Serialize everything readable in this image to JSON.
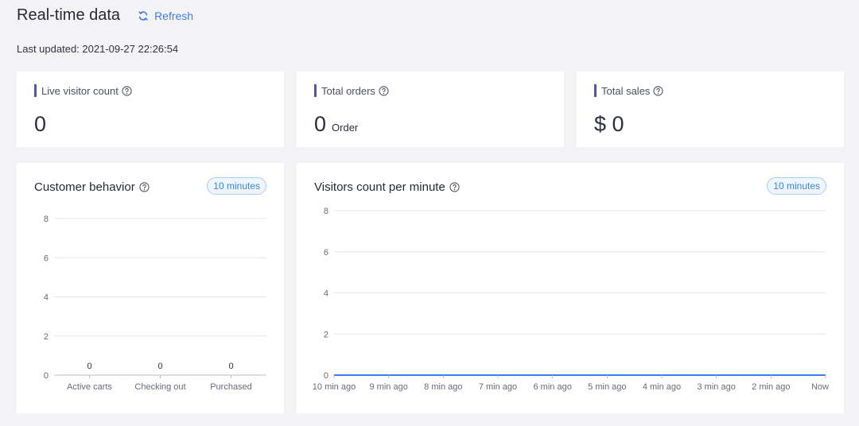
{
  "header": {
    "title": "Real-time data",
    "refresh_label": "Refresh",
    "last_updated": "Last updated: 2021-09-27 22:26:54"
  },
  "stats": [
    {
      "label": "Live visitor count",
      "value": "0",
      "unit": ""
    },
    {
      "label": "Total orders",
      "value": "0",
      "unit": "Order"
    },
    {
      "label": "Total sales",
      "value": "$ 0",
      "unit": ""
    }
  ],
  "charts": {
    "behavior": {
      "title": "Customer behavior",
      "range": "10 minutes"
    },
    "visitors": {
      "title": "Visitors count per minute",
      "range": "10 minutes"
    }
  },
  "colors": {
    "accent": "#3b7cf0",
    "stat_bar": "#4857b8",
    "line": "#3b7cf0"
  },
  "chart_data": [
    {
      "type": "bar",
      "title": "Customer behavior",
      "categories": [
        "Active carts",
        "Checking out",
        "Purchased"
      ],
      "values": [
        0,
        0,
        0
      ],
      "data_labels": [
        "0",
        "0",
        "0"
      ],
      "yticks": [
        "0",
        "2",
        "4",
        "6",
        "8"
      ],
      "ylim": [
        0,
        8
      ],
      "grid": true
    },
    {
      "type": "line",
      "title": "Visitors count per minute",
      "x": [
        "10 min ago",
        "9 min ago",
        "8 min ago",
        "7 min ago",
        "6 min ago",
        "5 min ago",
        "4 min ago",
        "3 min ago",
        "2 min ago",
        "Now"
      ],
      "values": [
        0,
        0,
        0,
        0,
        0,
        0,
        0,
        0,
        0,
        0
      ],
      "yticks": [
        "0",
        "2",
        "4",
        "6",
        "8"
      ],
      "ylim": [
        0,
        8
      ],
      "grid": true
    }
  ]
}
